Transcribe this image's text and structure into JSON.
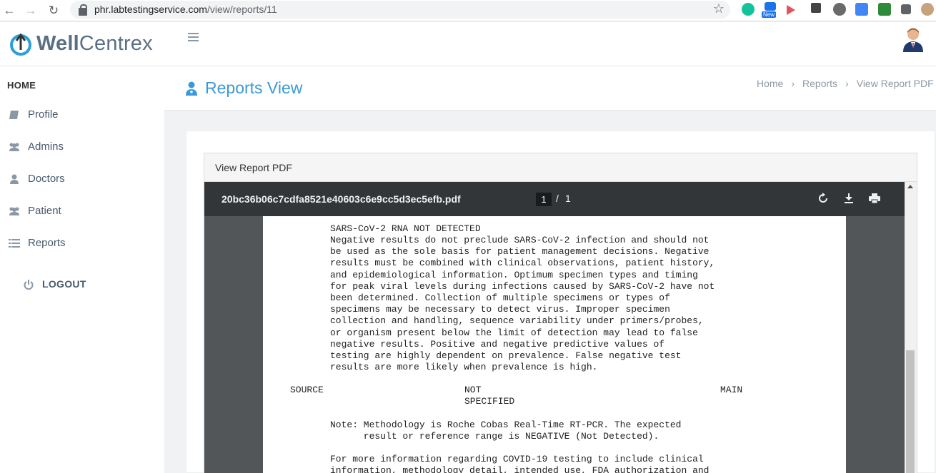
{
  "browser": {
    "url_host": "phr.labtestingservice.com",
    "url_path": "/view/reports/11",
    "extension_badge": "New"
  },
  "header": {
    "logo_bold": "Well",
    "logo_rest": "Centrex"
  },
  "sidebar": {
    "home_label": "HOME",
    "items": [
      {
        "label": "Profile",
        "icon": "book-icon"
      },
      {
        "label": "Admins",
        "icon": "users-icon"
      },
      {
        "label": "Doctors",
        "icon": "user-md-icon"
      },
      {
        "label": "Patient",
        "icon": "users-icon"
      },
      {
        "label": "Reports",
        "icon": "list-icon"
      }
    ],
    "logout_label": "LOGOUT"
  },
  "titlebar": {
    "title": "Reports View",
    "breadcrumb": [
      "Home",
      "Reports",
      "View Report PDF"
    ]
  },
  "panel": {
    "title": "View Report PDF"
  },
  "viewer": {
    "file_name": "20bc36b06c7cdfa8521e40603c6e9cc5d3ec5efb.pdf",
    "page_current": "1",
    "page_separator": "/",
    "page_total": "1"
  },
  "pdf": {
    "result_heading": "SARS-CoV-2 RNA NOT DETECTED",
    "result_paragraph": "Negative results do not preclude SARS-CoV-2 infection and should not\nbe used as the sole basis for patient management decisions. Negative\nresults must be combined with clinical observations, patient history,\nand epidemiological information. Optimum specimen types and timing\nfor peak viral levels during infections caused by SARS-CoV-2 have not\nbeen determined. Collection of multiple specimens or types of\nspecimens may be necessary to detect virus. Improper specimen\ncollection and handling, sequence variability under primers/probes,\nor organism present below the limit of detection may lead to false\nnegative results. Positive and negative predictive values of\ntesting are highly dependent on prevalence. False negative test\nresults are more likely when prevalence is high.",
    "source_label": "SOURCE",
    "source_value": "NOT\nSPECIFIED",
    "source_location": "MAIN",
    "note": "Note: Methodology is Roche Cobas Real-Time RT-PCR. The expected\n      result or reference range is NEGATIVE (Not Detected).",
    "more_info": "For more information regarding COVID-19 testing to include clinical\ninformation, methodology detail, intended use, FDA authorization and"
  }
}
